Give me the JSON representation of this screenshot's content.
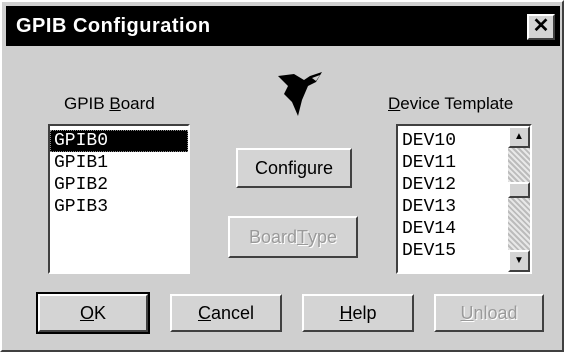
{
  "dialog": {
    "title": "GPIB Configuration",
    "close_glyph": "✕"
  },
  "board_list": {
    "label_pre": "GPIB ",
    "label_mnemonic": "B",
    "label_post": "oard",
    "items": [
      "GPIB0",
      "GPIB1",
      "GPIB2",
      "GPIB3"
    ],
    "selected": "GPIB0"
  },
  "template_list": {
    "label_mnemonic": "D",
    "label_post": "evice Template",
    "items": [
      "DEV10",
      "DEV11",
      "DEV12",
      "DEV13",
      "DEV14",
      "DEV15"
    ]
  },
  "buttons": {
    "configure": {
      "pre": "Confi",
      "mnemonic": "g",
      "post": "ure"
    },
    "board_type": {
      "pre": "Board ",
      "mnemonic": "T",
      "post": "ype"
    },
    "ok": {
      "pre": "",
      "mnemonic": "O",
      "post": "K"
    },
    "cancel": {
      "pre": "",
      "mnemonic": "C",
      "post": "ancel"
    },
    "help": {
      "pre": "",
      "mnemonic": "H",
      "post": "elp"
    },
    "unload": {
      "pre": "",
      "mnemonic": "U",
      "post": "nload"
    }
  },
  "icons": {
    "logo": "ni-eagle-logo",
    "scroll_up": "scroll-up-arrow-icon",
    "scroll_down": "scroll-down-arrow-icon"
  },
  "colors": {
    "titlebar": "#000000",
    "dialog_bg": "#cfcfcf",
    "selection": "#000000",
    "disabled_text": "#9a9a9a"
  }
}
